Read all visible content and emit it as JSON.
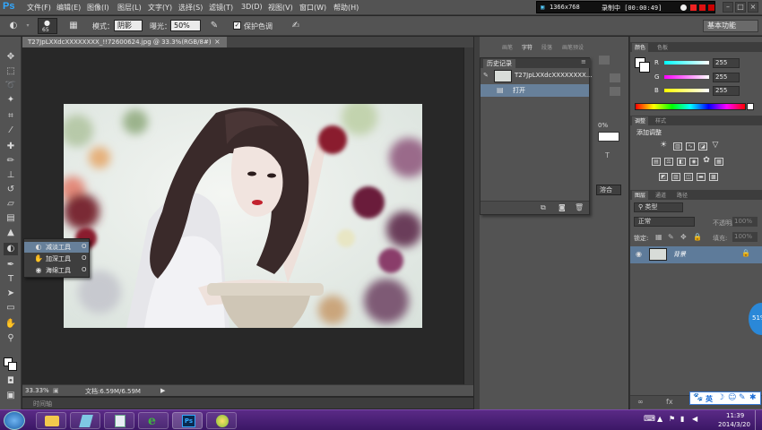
{
  "app": {
    "logo": "Ps"
  },
  "menu": [
    "文件(F)",
    "编辑(E)",
    "图像(I)",
    "图层(L)",
    "文字(Y)",
    "选择(S)",
    "滤镜(T)",
    "3D(D)",
    "视图(V)",
    "窗口(W)",
    "帮助(H)"
  ],
  "recorder": {
    "resolution": "1366x768",
    "status": "录制中 [00:00:49]"
  },
  "options": {
    "brush_size": "65",
    "mode_label": "模式：",
    "mode_value": "阴影",
    "exposure_label": "曝光：",
    "exposure_value": "50%",
    "protect_tones_label": "保护色调",
    "workspace": "基本功能"
  },
  "document": {
    "tab_title": "T27JpLXXdcXXXXXXXX_!!72600624.jpg @ 33.3%(RGB/8#)",
    "zoom": "33.33%",
    "doc_size": "文档:6.59M/6.59M",
    "timeline_label": "时间轴"
  },
  "flyout": {
    "items": [
      {
        "label": "减淡工具",
        "key": "O"
      },
      {
        "label": "加深工具",
        "key": "O"
      },
      {
        "label": "海绵工具",
        "key": "O"
      }
    ]
  },
  "middle_dock": {
    "tabs": [
      "画笔",
      "字符",
      "段落",
      "画笔预设"
    ],
    "history": {
      "title": "历史记录",
      "snapshot_name": "T27JpLXXdcXXXXXXXX...",
      "state_open": "打开"
    },
    "side_values": [
      "0%"
    ],
    "side_select": "溶合"
  },
  "color_panel": {
    "tabs": [
      "颜色",
      "色板"
    ],
    "r_label": "R",
    "g_label": "G",
    "b_label": "B",
    "r": "255",
    "g": "255",
    "b": "255"
  },
  "adjust_panel": {
    "tabs": [
      "调整",
      "样式"
    ],
    "title": "添加调整"
  },
  "layers_panel": {
    "tabs": [
      "图层",
      "通道",
      "路径"
    ],
    "filter": "类型",
    "blend_mode": "正常",
    "opacity_label": "不透明度:",
    "opacity_value": "100%",
    "lock_label": "锁定:",
    "fill_label": "填充:",
    "fill_value": "100%",
    "layer_name": "背景"
  },
  "float_badge": "51%",
  "ime": {
    "lang": "英"
  },
  "clock": {
    "time": "11:39",
    "date": "2014/3/20"
  },
  "colors": {
    "accent_blue": "#31a8ff",
    "history_selected": "#67809a",
    "layer_selected": "#5e7b9a",
    "taskbar": "#4a1f78"
  }
}
